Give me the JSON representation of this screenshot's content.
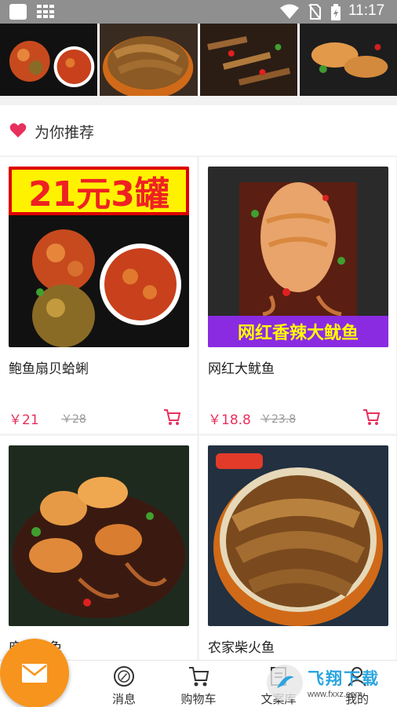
{
  "status_bar": {
    "time": "11:17"
  },
  "recommend": {
    "title": "为你推荐"
  },
  "products": [
    {
      "name": "鲍鱼扇贝蛤蜊",
      "price": "￥21",
      "old_price": "￥28",
      "image_label": "21元3罐"
    },
    {
      "name": "网红大鱿鱼",
      "price": "￥18.8",
      "old_price": "￥23.8",
      "image_label": "网红香辣大鱿鱼"
    },
    {
      "name": "麻辣海兔",
      "price": "",
      "old_price": "",
      "image_label": ""
    },
    {
      "name": "农家柴火鱼",
      "price": "",
      "old_price": "",
      "image_label": ""
    }
  ],
  "nav": {
    "home_label": "",
    "messages_label": "消息",
    "cart_label": "购物车",
    "library_label": "文案库",
    "mine_label": "我的"
  },
  "watermark": {
    "cn": "飞翔下载",
    "url": "www.fxxz.com"
  },
  "colors": {
    "price": "#e8305c",
    "fab": "#f7941d",
    "heart": "#e8305c",
    "status_bar": "#8f8f8f"
  },
  "icons": [
    "wifi-icon",
    "no-sim-icon",
    "battery-icon",
    "heart-icon",
    "cart-icon",
    "mail-icon",
    "compass-icon",
    "shopping-cart-icon",
    "document-icon",
    "user-icon"
  ]
}
